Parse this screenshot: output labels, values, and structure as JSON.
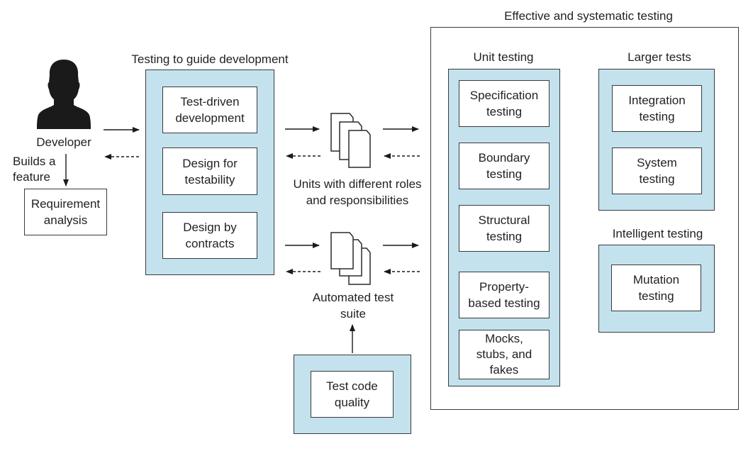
{
  "developer": {
    "label": "Developer",
    "icon": "person-silhouette-icon",
    "action_label": "Builds a\nfeature",
    "requirement_box": "Requirement\nanalysis"
  },
  "guide_dev": {
    "title": "Testing to guide development",
    "items": [
      "Test-driven\ndevelopment",
      "Design for\ntestability",
      "Design by\ncontracts"
    ]
  },
  "units": {
    "icon": "documents-stack-icon",
    "label": "Units with different roles\nand responsibilities"
  },
  "suite": {
    "icon": "documents-stack-icon",
    "label": "Automated test\nsuite"
  },
  "test_code_quality": {
    "label": "Test code\nquality"
  },
  "effective": {
    "title": "Effective and systematic testing",
    "unit_testing": {
      "title": "Unit testing",
      "items": [
        "Specification\ntesting",
        "Boundary\ntesting",
        "Structural\ntesting",
        "Property-\nbased testing",
        "Mocks,\nstubs, and\nfakes"
      ]
    },
    "larger_tests": {
      "title": "Larger tests",
      "items": [
        "Integration\ntesting",
        "System\ntesting"
      ]
    },
    "intelligent_testing": {
      "title": "Intelligent testing",
      "items": [
        "Mutation\ntesting"
      ]
    }
  },
  "colors": {
    "panel_fill": "#c3e2ee",
    "stroke": "#3a3a3a",
    "text": "#231f20"
  }
}
